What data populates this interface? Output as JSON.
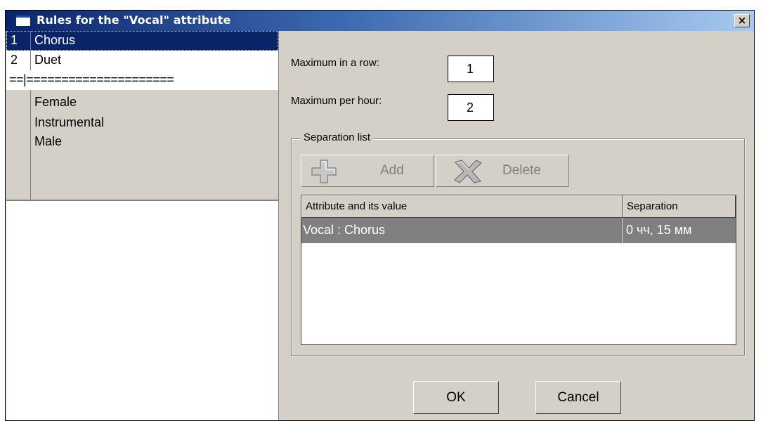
{
  "window": {
    "title": "Rules for the \"Vocal\" attribute",
    "close_label": "×"
  },
  "list": {
    "rows": [
      {
        "num": "1",
        "label": "Chorus"
      },
      {
        "num": "2",
        "label": "Duet"
      },
      {
        "separator": "==|====================="
      },
      {
        "num": "",
        "label": "Female"
      },
      {
        "num": "",
        "label": "Instrumental"
      },
      {
        "num": "",
        "label": "Male"
      }
    ]
  },
  "rules": {
    "max_in_row_label": "Maximum in a row:",
    "max_in_row_value": "1",
    "max_per_hour_label": "Maximum per hour:",
    "max_per_hour_value": "2"
  },
  "separation": {
    "legend": "Separation list",
    "add_label": "Add",
    "delete_label": "Delete",
    "columns": [
      "Attribute and its value",
      "Separation"
    ],
    "rows": [
      {
        "attribute": "Vocal : Chorus",
        "separation": "0 чч, 15 мм"
      }
    ]
  },
  "buttons": {
    "ok": "OK",
    "cancel": "Cancel"
  },
  "colors": {
    "selection": "#0a246a",
    "face": "#d4d0c8",
    "row_highlight": "#808080"
  }
}
